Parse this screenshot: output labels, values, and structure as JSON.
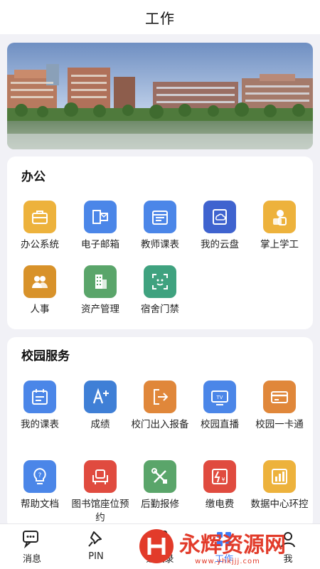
{
  "header": {
    "title": "工作"
  },
  "sections": [
    {
      "title": "办公",
      "items": [
        {
          "label": "办公系统",
          "icon": "briefcase-icon",
          "color": "#edb23c"
        },
        {
          "label": "电子邮箱",
          "icon": "exchange-mail-icon",
          "color": "#4b86e8"
        },
        {
          "label": "教师课表",
          "icon": "schedule-icon",
          "color": "#4b86e8"
        },
        {
          "label": "我的云盘",
          "icon": "cloud-disk-icon",
          "color": "#3f63cf"
        },
        {
          "label": "掌上学工",
          "icon": "student-work-icon",
          "color": "#edb23c"
        },
        {
          "label": "人事",
          "icon": "people-icon",
          "color": "#d8922a"
        },
        {
          "label": "资产管理",
          "icon": "building-icon",
          "color": "#5aa56a"
        },
        {
          "label": "宿舍门禁",
          "icon": "face-scan-icon",
          "color": "#3fa27f"
        }
      ]
    },
    {
      "title": "校园服务",
      "items": [
        {
          "label": "我的课表",
          "icon": "calendar-icon",
          "color": "#4b86e8"
        },
        {
          "label": "成绩",
          "icon": "grade-icon",
          "color": "#3f7fd6"
        },
        {
          "label": "校门出入报备",
          "icon": "gate-exit-icon",
          "color": "#e0873a"
        },
        {
          "label": "校园直播",
          "icon": "tv-icon",
          "color": "#4b86e8"
        },
        {
          "label": "校园一卡通",
          "icon": "card-icon",
          "color": "#e0873a"
        },
        {
          "label": "帮助文档",
          "icon": "help-bulb-icon",
          "color": "#4b86e8"
        },
        {
          "label": "图书馆座位预约",
          "icon": "seat-icon",
          "color": "#e04b3f"
        },
        {
          "label": "后勤报修",
          "icon": "repair-tools-icon",
          "color": "#5aa56a"
        },
        {
          "label": "缴电费",
          "icon": "electricity-fee-icon",
          "color": "#e04b3f"
        },
        {
          "label": "数据中心环控",
          "icon": "data-chart-icon",
          "color": "#edb23c"
        }
      ]
    }
  ],
  "tabbar": [
    {
      "label": "消息",
      "icon": "message-icon",
      "active": false
    },
    {
      "label": "PIN",
      "icon": "pin-icon",
      "active": false
    },
    {
      "label": "通讯录",
      "icon": "contacts-icon",
      "active": false
    },
    {
      "label": "工作",
      "icon": "work-icon",
      "active": true
    },
    {
      "label": "我",
      "icon": "me-icon",
      "active": false
    }
  ],
  "watermark": {
    "text": "永辉资源网",
    "url": "www.yhkjjj.com"
  }
}
